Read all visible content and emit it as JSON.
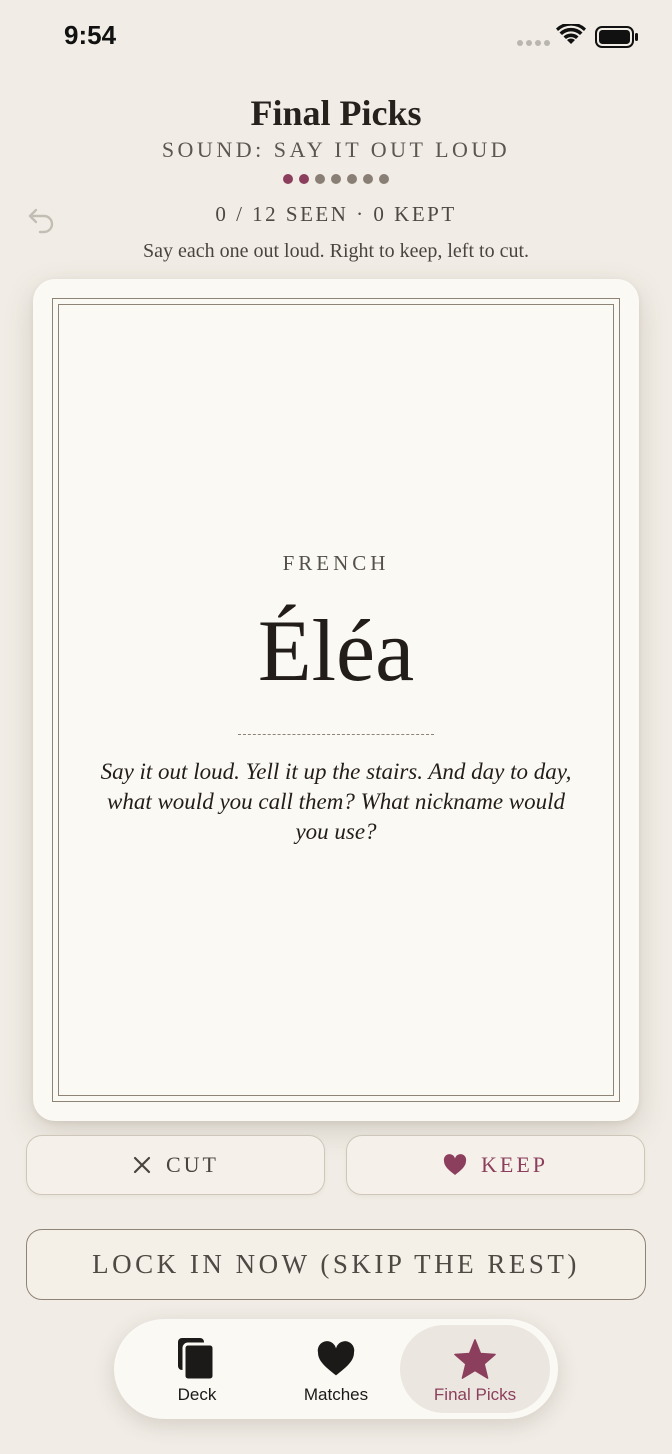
{
  "status_bar": {
    "time": "9:54"
  },
  "header": {
    "title": "Final Picks",
    "subtitle": "SOUND: SAY IT OUT LOUD",
    "progress": {
      "total_steps": 7,
      "completed_steps": 2
    },
    "counter": "0 / 12 SEEN · 0 KEPT",
    "instructions": "Say each one out loud. Right to keep, left to cut."
  },
  "card": {
    "origin": "FRENCH",
    "name": "Éléa",
    "prompt": "Say it out loud. Yell it up the stairs. And day to day, what would you call them? What nickname would you use?"
  },
  "actions": {
    "cut_label": "CUT",
    "keep_label": "KEEP",
    "lock_label": "LOCK IN NOW (SKIP THE REST)"
  },
  "tabs": [
    {
      "label": "Deck",
      "icon": "cards-icon",
      "active": false
    },
    {
      "label": "Matches",
      "icon": "heart-icon",
      "active": false
    },
    {
      "label": "Final Picks",
      "icon": "star-icon",
      "active": true
    }
  ],
  "colors": {
    "background": "#f1ede6",
    "card": "#fbf9f4",
    "accent": "#8c3f5d",
    "dot_active": "#8c3f5d",
    "dot_inactive": "#8a7f76",
    "text_primary": "#26211d",
    "text_secondary": "#5d5650"
  }
}
